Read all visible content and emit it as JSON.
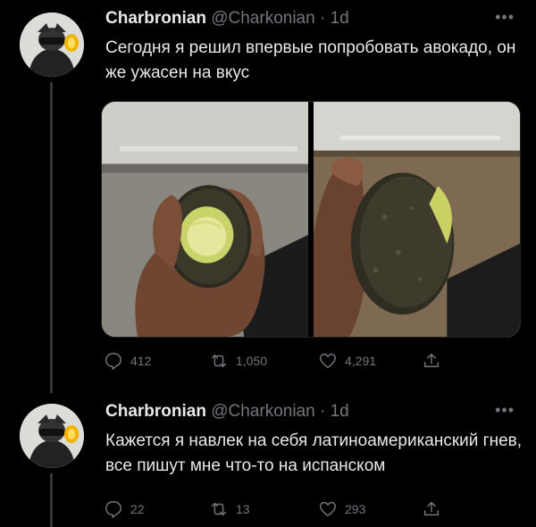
{
  "tweets": [
    {
      "display_name": "Charbronian",
      "handle": "@Charkonian",
      "separator": "·",
      "time": "1d",
      "text": "Сегодня я решил впервые попробовать авокадо, он же ужасен на вкус",
      "stats": {
        "replies": "412",
        "retweets": "1,050",
        "likes": "4,291"
      }
    },
    {
      "display_name": "Charbronian",
      "handle": "@Charkonian",
      "separator": "·",
      "time": "1d",
      "text": "Кажется я навлек на себя латиноамериканский гнев, все пишут мне что-то на испанском",
      "stats": {
        "replies": "22",
        "retweets": "13",
        "likes": "293"
      }
    }
  ],
  "icons": {
    "more": "more-icon",
    "reply": "reply-icon",
    "retweet": "retweet-icon",
    "like": "heart-icon",
    "share": "share-icon"
  },
  "colors": {
    "background": "#000000",
    "text": "#e7e9ea",
    "muted": "#71767b"
  }
}
